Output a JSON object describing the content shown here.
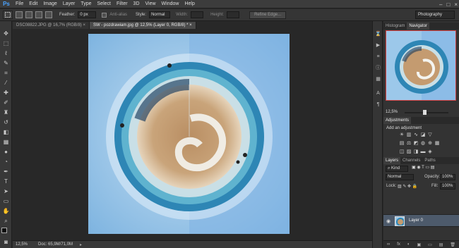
{
  "app": {
    "logo": "Ps"
  },
  "menu": [
    "File",
    "Edit",
    "Image",
    "Layer",
    "Type",
    "Select",
    "Filter",
    "3D",
    "View",
    "Window",
    "Help"
  ],
  "window_controls": {
    "minimize": "–",
    "restore": "□",
    "close": "×"
  },
  "options": {
    "feather_label": "Feather:",
    "feather_value": "0 px",
    "anti_alias_label": "Anti-alias",
    "style_label": "Style:",
    "style_value": "Normal",
    "width_label": "Width:",
    "height_label": "Height:",
    "refine_edge_label": "Refine Edge...",
    "workspace": "Photography"
  },
  "tabs": [
    {
      "label": "DSC08822.JPG @ 16,7% (RGB/8)",
      "close": "×",
      "active": false
    },
    {
      "label": "SW - pozdrawiam.jpg @ 12,5% (Layer 0, RGB/8) *",
      "close": "×",
      "active": true
    }
  ],
  "status": {
    "zoom": "12,5%",
    "doc_info": "Doc: 65,9M/71,0M",
    "arrow": "▸"
  },
  "navigator": {
    "tabs": [
      "Histogram",
      "Navigator"
    ],
    "active_tab": "Navigator",
    "zoom": "12,5%"
  },
  "adjustments": {
    "tab": "Adjustments",
    "title": "Add an adjustment",
    "icons": [
      "brightness-icon",
      "levels-icon",
      "curves-icon",
      "exposure-icon",
      "vibrance-icon",
      "hue-icon",
      "color-balance-icon",
      "bw-icon",
      "photo-filter-icon",
      "channel-mixer-icon",
      "lookup-icon",
      "invert-icon",
      "posterize-icon",
      "threshold-icon",
      "gradient-map-icon",
      "selective-color-icon"
    ]
  },
  "layers": {
    "tabs": [
      "Layers",
      "Channels",
      "Paths"
    ],
    "active_tab": "Layers",
    "kind_label": "Kind",
    "blend_mode": "Normal",
    "opacity_label": "Opacity:",
    "opacity_value": "100%",
    "lock_label": "Lock:",
    "fill_label": "Fill:",
    "fill_value": "100%",
    "items": [
      {
        "name": "Layer 0",
        "visible": true,
        "selected": true
      }
    ],
    "footer_icons": [
      "∞",
      "fx",
      "◐",
      "▣",
      "▭",
      "▤",
      "🗑"
    ]
  },
  "colors": {
    "accent": "#4aa3ff",
    "selected_layer": "#4d5a6b",
    "navigator_frame": "#d04040"
  }
}
